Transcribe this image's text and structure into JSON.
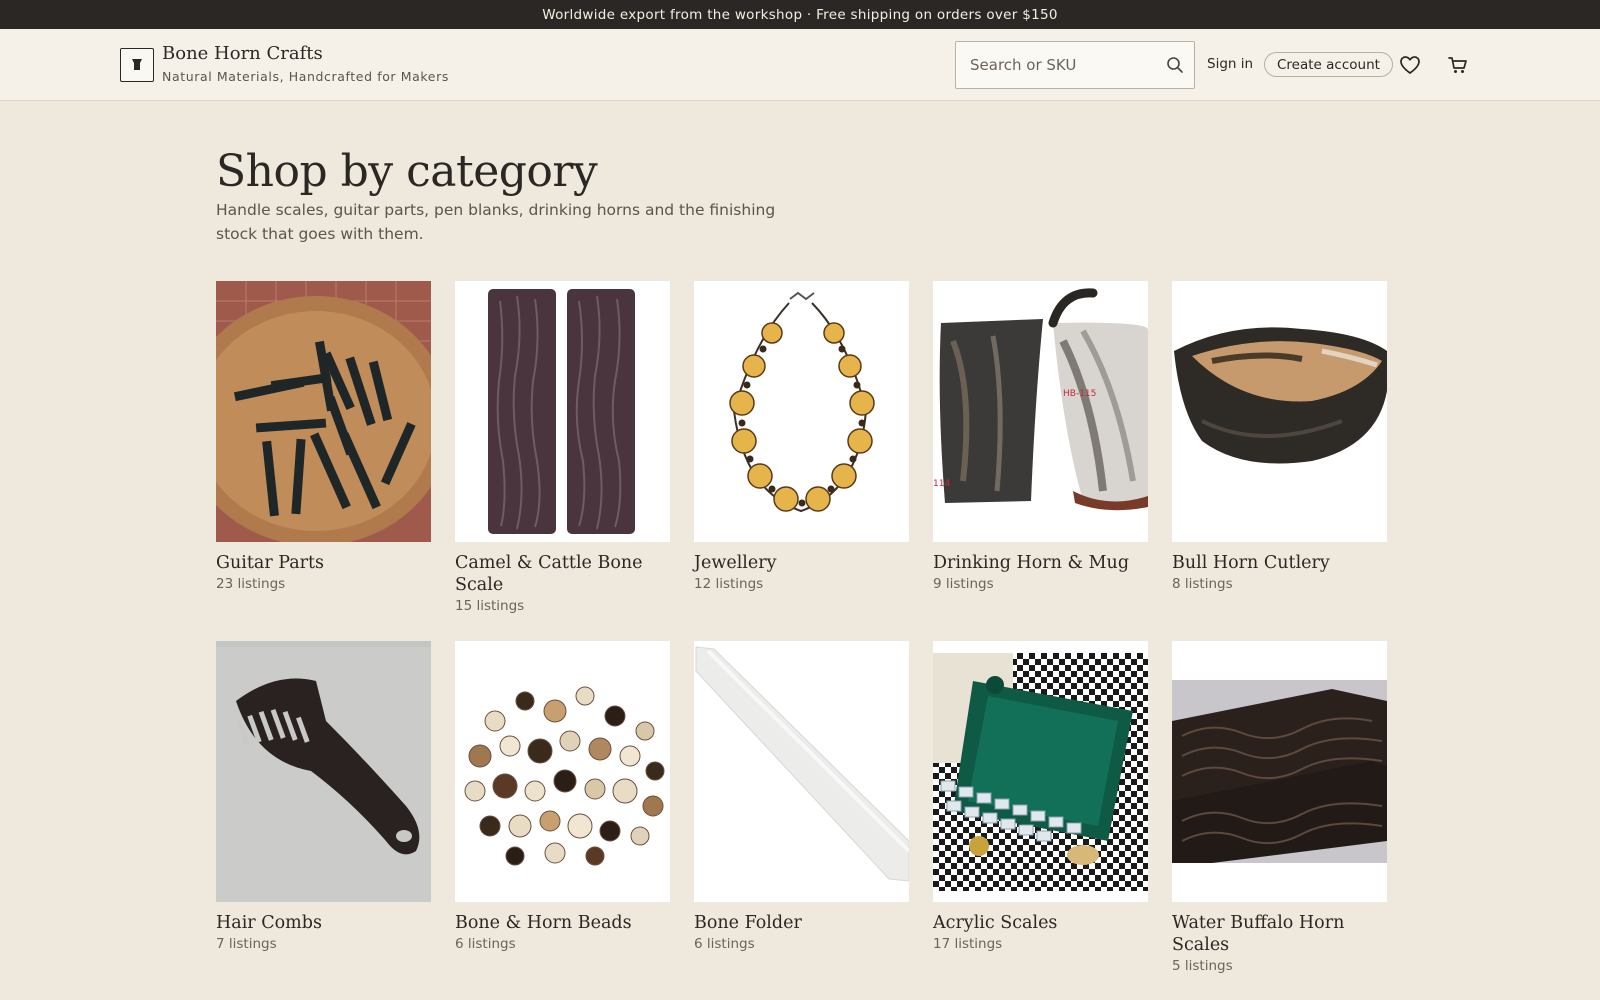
{
  "promo": {
    "text": "Worldwide export from the workshop · Free shipping on orders over $150"
  },
  "header": {
    "brand_name": "Bone Horn Crafts",
    "tagline": "Natural Materials, Handcrafted for Makers",
    "search_placeholder": "Search or SKU",
    "signin_label": "Sign in",
    "create_account_label": "Create account",
    "icons": [
      "logo-mark-icon",
      "search-icon",
      "heart-icon",
      "cart-icon"
    ]
  },
  "main": {
    "title": "Shop by category",
    "intro": "Handle scales, guitar parts, pen blanks, drinking horns and the finishing stock that goes with them."
  },
  "categories": [
    {
      "title": "Guitar Parts",
      "count": "23 listings"
    },
    {
      "title": "Camel & Cattle Bone Scale",
      "count": "15 listings"
    },
    {
      "title": "Jewellery",
      "count": "12 listings"
    },
    {
      "title": "Drinking Horn & Mug",
      "count": "9 listings"
    },
    {
      "title": "Bull Horn Cutlery",
      "count": "8 listings"
    },
    {
      "title": "Hair Combs",
      "count": "7 listings"
    },
    {
      "title": "Bone & Horn Beads",
      "count": "6 listings"
    },
    {
      "title": "Bone Folder",
      "count": "6 listings"
    },
    {
      "title": "Acrylic Scales",
      "count": "17 listings"
    },
    {
      "title": "Water Buffalo Horn Scales",
      "count": "5 listings"
    }
  ],
  "colors": {
    "page_background": "#efe8dc",
    "header_background": "#f5f1e8",
    "promo_background": "#2b2724",
    "text": "#2b2724",
    "muted_text": "#6b645a"
  }
}
